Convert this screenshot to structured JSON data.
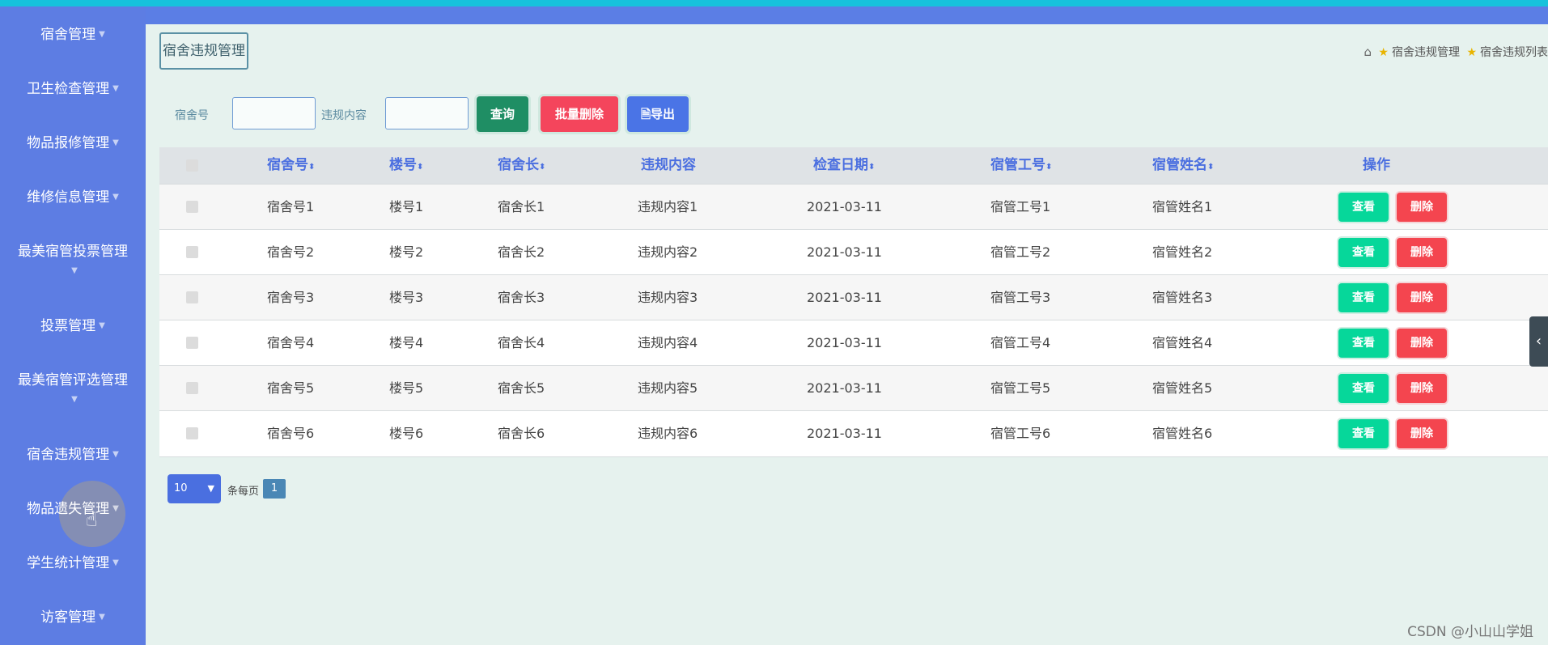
{
  "sidebar": {
    "items": [
      {
        "label": "宿舍管理"
      },
      {
        "label": "卫生检查管理"
      },
      {
        "label": "物品报修管理"
      },
      {
        "label": "维修信息管理"
      },
      {
        "label": "最美宿管投票管理"
      },
      {
        "label": "投票管理"
      },
      {
        "label": "最美宿管评选管理"
      },
      {
        "label": "宿舍违规管理"
      },
      {
        "label": "物品遗失管理"
      },
      {
        "label": "学生统计管理"
      },
      {
        "label": "访客管理"
      }
    ]
  },
  "header": {
    "page_title": "宿舍违规管理",
    "breadcrumb": [
      "宿舍违规管理",
      "宿舍违规列表"
    ]
  },
  "search": {
    "room_label": "宿舍号",
    "room_value": "",
    "violation_label": "违规内容",
    "violation_value": "",
    "query_label": "查询",
    "batch_delete_label": "批量删除",
    "export_label": "导出"
  },
  "table": {
    "columns": [
      "宿舍号",
      "楼号",
      "宿舍长",
      "违规内容",
      "检查日期",
      "宿管工号",
      "宿管姓名",
      "操作"
    ],
    "rows": [
      {
        "room": "宿舍号1",
        "building": "楼号1",
        "leader": "宿舍长1",
        "content": "违规内容1",
        "date": "2021-03-11",
        "staff_no": "宿管工号1",
        "staff_name": "宿管姓名1"
      },
      {
        "room": "宿舍号2",
        "building": "楼号2",
        "leader": "宿舍长2",
        "content": "违规内容2",
        "date": "2021-03-11",
        "staff_no": "宿管工号2",
        "staff_name": "宿管姓名2"
      },
      {
        "room": "宿舍号3",
        "building": "楼号3",
        "leader": "宿舍长3",
        "content": "违规内容3",
        "date": "2021-03-11",
        "staff_no": "宿管工号3",
        "staff_name": "宿管姓名3"
      },
      {
        "room": "宿舍号4",
        "building": "楼号4",
        "leader": "宿舍长4",
        "content": "违规内容4",
        "date": "2021-03-11",
        "staff_no": "宿管工号4",
        "staff_name": "宿管姓名4"
      },
      {
        "room": "宿舍号5",
        "building": "楼号5",
        "leader": "宿舍长5",
        "content": "违规内容5",
        "date": "2021-03-11",
        "staff_no": "宿管工号5",
        "staff_name": "宿管姓名5"
      },
      {
        "room": "宿舍号6",
        "building": "楼号6",
        "leader": "宿舍长6",
        "content": "违规内容6",
        "date": "2021-03-11",
        "staff_no": "宿管工号6",
        "staff_name": "宿管姓名6"
      }
    ],
    "view_label": "查看",
    "delete_label": "删除"
  },
  "pagination": {
    "page_size": "10",
    "per_page_label": "条每页",
    "current_page": "1"
  },
  "watermark": "CSDN @小山山学姐",
  "colors": {
    "sidebar": "#5d7de3",
    "accent_top": "#16c2dc",
    "view_button": "#06d79a",
    "delete_button": "#f4454f",
    "query_button": "#1f8e64",
    "export_button": "#4a74e6"
  }
}
